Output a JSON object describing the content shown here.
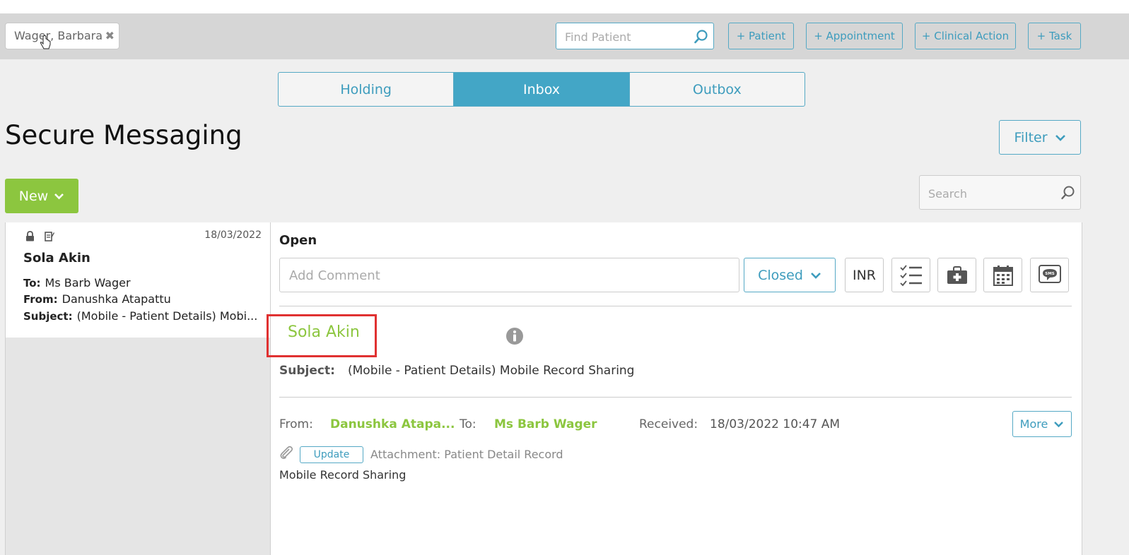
{
  "header": {
    "patient_tab": {
      "name": "Wager, Barbara",
      "close_glyph": "✖"
    },
    "find_patient_placeholder": "Find Patient",
    "buttons": {
      "patient": "+ Patient",
      "appointment": "+ Appointment",
      "clinical_action": "+ Clinical Action",
      "task": "+ Task"
    }
  },
  "tabs": [
    "Holding",
    "Inbox",
    "Outbox"
  ],
  "active_tab": "Inbox",
  "page": {
    "title": "Secure Messaging",
    "filter_label": "Filter",
    "new_label": "New",
    "search_placeholder": "Search"
  },
  "messages": [
    {
      "date": "18/03/2022",
      "sender": "Sola Akin",
      "to_label": "To:",
      "to": "Ms Barb Wager",
      "from_label": "From:",
      "from": "Danushka Atapattu",
      "subject_label": "Subject:",
      "subject": "(Mobile - Patient Details) Mobi..."
    }
  ],
  "detail": {
    "status": "Open",
    "comment_placeholder": "Add Comment",
    "state_select": "Closed",
    "inr_label": "INR",
    "sender": "Sola Akin",
    "subject_label": "Subject:",
    "subject": "(Mobile - Patient Details) Mobile Record Sharing",
    "from_label": "From:",
    "from": "Danushka Atapa...",
    "to_label": "To:",
    "to": "Ms Barb Wager",
    "received_label": "Received:",
    "received": "18/03/2022 10:47 AM",
    "more_label": "More",
    "update_label": "Update",
    "attachment": "Attachment: Patient Detail Record",
    "body": "Mobile Record Sharing"
  },
  "icons": [
    "search-icon",
    "chevron-down-icon",
    "lock-icon",
    "note-icon",
    "checklist-icon",
    "medical-kit-icon",
    "calendar-icon",
    "sms-icon",
    "info-icon",
    "paperclip-icon"
  ],
  "colors": {
    "accent_blue": "#43a6c6",
    "accent_green": "#8cc63f",
    "highlight_red": "#e03131"
  }
}
